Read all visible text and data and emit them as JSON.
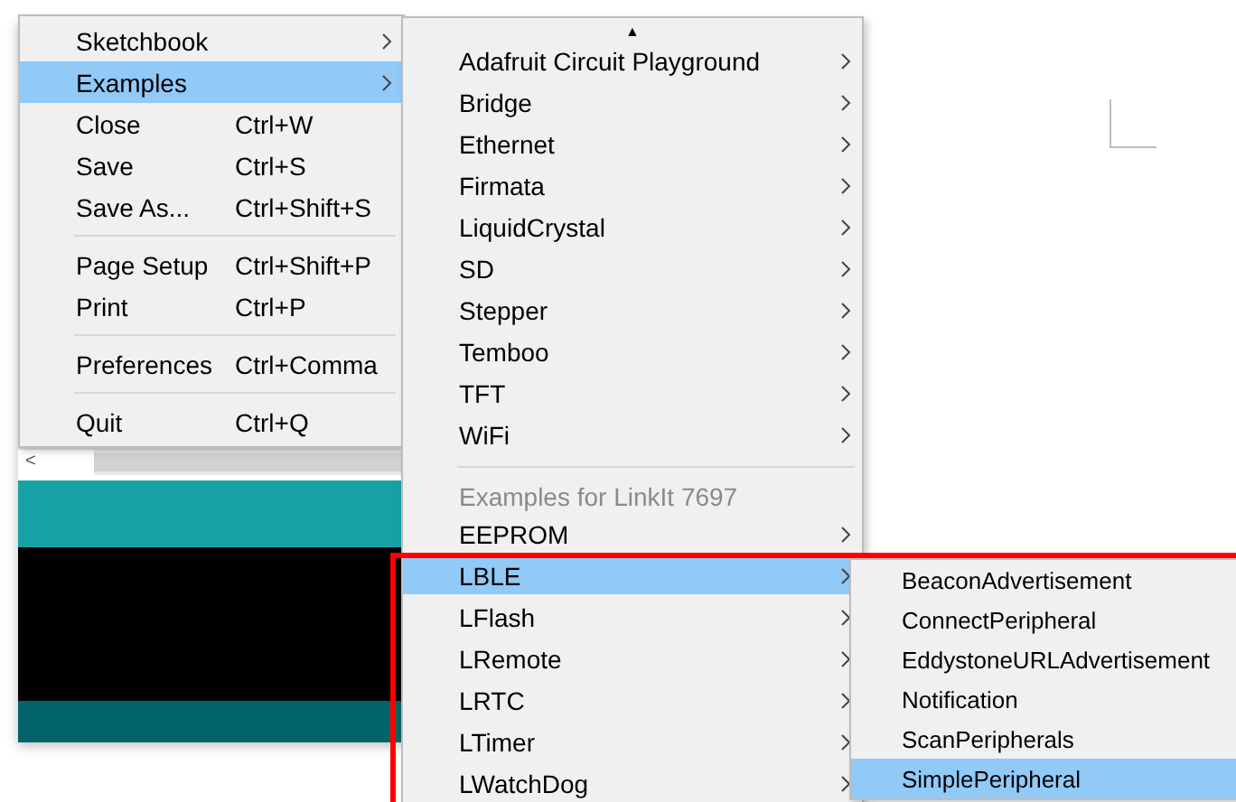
{
  "file_menu": {
    "items": [
      {
        "kind": "item",
        "label": "Sketchbook",
        "submenu": true,
        "selected": false
      },
      {
        "kind": "item",
        "label": "Examples",
        "submenu": true,
        "selected": true
      },
      {
        "kind": "item",
        "label": "Close",
        "shortcut": "Ctrl+W",
        "selected": false
      },
      {
        "kind": "item",
        "label": "Save",
        "shortcut": "Ctrl+S",
        "selected": false
      },
      {
        "kind": "item",
        "label": "Save As...",
        "shortcut": "Ctrl+Shift+S",
        "selected": false
      },
      {
        "kind": "separator"
      },
      {
        "kind": "item",
        "label": "Page Setup",
        "shortcut": "Ctrl+Shift+P",
        "selected": false
      },
      {
        "kind": "item",
        "label": "Print",
        "shortcut": "Ctrl+P",
        "selected": false
      },
      {
        "kind": "separator"
      },
      {
        "kind": "item",
        "label": "Preferences",
        "shortcut": "Ctrl+Comma",
        "selected": false
      },
      {
        "kind": "separator"
      },
      {
        "kind": "item",
        "label": "Quit",
        "shortcut": "Ctrl+Q",
        "selected": false
      }
    ]
  },
  "editor": {
    "scroll_left": "<"
  },
  "examples_menu": {
    "scroll_up": "▲",
    "items": [
      {
        "kind": "item",
        "label": "Adafruit Circuit Playground",
        "submenu": true,
        "selected": false
      },
      {
        "kind": "item",
        "label": "Bridge",
        "submenu": true,
        "selected": false
      },
      {
        "kind": "item",
        "label": "Ethernet",
        "submenu": true,
        "selected": false
      },
      {
        "kind": "item",
        "label": "Firmata",
        "submenu": true,
        "selected": false
      },
      {
        "kind": "item",
        "label": "LiquidCrystal",
        "submenu": true,
        "selected": false
      },
      {
        "kind": "item",
        "label": "SD",
        "submenu": true,
        "selected": false
      },
      {
        "kind": "item",
        "label": "Stepper",
        "submenu": true,
        "selected": false
      },
      {
        "kind": "item",
        "label": "Temboo",
        "submenu": true,
        "selected": false
      },
      {
        "kind": "item",
        "label": "TFT",
        "submenu": true,
        "selected": false
      },
      {
        "kind": "item",
        "label": "WiFi",
        "submenu": true,
        "selected": false
      },
      {
        "kind": "separator"
      },
      {
        "kind": "header",
        "label": "Examples for LinkIt 7697"
      },
      {
        "kind": "item",
        "label": "EEPROM",
        "submenu": true,
        "selected": false
      },
      {
        "kind": "item",
        "label": "LBLE",
        "submenu": true,
        "selected": true
      },
      {
        "kind": "item",
        "label": "LFlash",
        "submenu": true,
        "selected": false
      },
      {
        "kind": "item",
        "label": "LRemote",
        "submenu": true,
        "selected": false
      },
      {
        "kind": "item",
        "label": "LRTC",
        "submenu": true,
        "selected": false
      },
      {
        "kind": "item",
        "label": "LTimer",
        "submenu": true,
        "selected": false
      },
      {
        "kind": "item",
        "label": "LWatchDog",
        "submenu": true,
        "selected": false
      }
    ]
  },
  "lble_menu": {
    "items": [
      {
        "kind": "item",
        "label": "BeaconAdvertisement",
        "selected": false
      },
      {
        "kind": "item",
        "label": "ConnectPeripheral",
        "selected": false
      },
      {
        "kind": "item",
        "label": "EddystoneURLAdvertisement",
        "selected": false
      },
      {
        "kind": "item",
        "label": "Notification",
        "selected": false
      },
      {
        "kind": "item",
        "label": "ScanPeripherals",
        "selected": false
      },
      {
        "kind": "item",
        "label": "SimplePeripheral",
        "selected": true
      }
    ]
  }
}
